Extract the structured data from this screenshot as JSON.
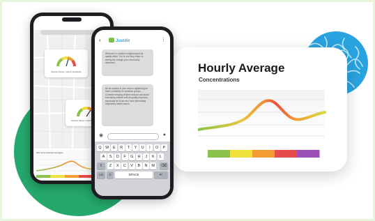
{
  "card": {
    "title": "Hourly Average",
    "subtitle": "Concentrations",
    "curve_gradient": [
      "#8bc34a",
      "#f6c445",
      "#f28b30",
      "#e8503b",
      "#f4a23a",
      "#d7d940"
    ],
    "color_scale": [
      "#8bc34a",
      "#f0e13c",
      "#f39c32",
      "#e74c4c",
      "#9b4fb6"
    ]
  },
  "left_phone": {
    "map_cards": [
      {
        "label": "Monitor Name / Hourly Readings",
        "gauge_level": 0.55
      },
      {
        "label": "Monitor Name / Hourly Readings",
        "gauge_level": 0.7
      }
    ],
    "mini_chart_title": "24hr Fine Particles Averages",
    "mini_scale": [
      "#8bc34a",
      "#f0e13c",
      "#f39c32",
      "#e74c4c",
      "#9b4fb6"
    ]
  },
  "right_phone": {
    "brand": "JustAir",
    "back_icon": "chevron-left-icon",
    "menu_icon": "kebab-icon",
    "messages": [
      "Welcome to JustAir's neighborhood air quality alerts. You're one step closer to seeing the change your community deserves!",
      "An air monitor in your area is registering air that's unhealthy for sensitive groups. Consider keeping children indoors and avoid exercising outside until air quality improves, especially for those who have preexisting respiratory health issues."
    ],
    "keyboard": {
      "row1": [
        "Q",
        "W",
        "E",
        "R",
        "T",
        "Y",
        "U",
        "I",
        "O",
        "P"
      ],
      "row2": [
        "A",
        "S",
        "D",
        "F",
        "G",
        "H",
        "J",
        "K",
        "L"
      ],
      "row3": [
        "Z",
        "X",
        "C",
        "V",
        "B",
        "N",
        "M"
      ],
      "shift": "⇧",
      "backspace": "⌫",
      "numbers": "123",
      "emoji": "☺",
      "space": "SPACE",
      "return": "↵"
    }
  }
}
